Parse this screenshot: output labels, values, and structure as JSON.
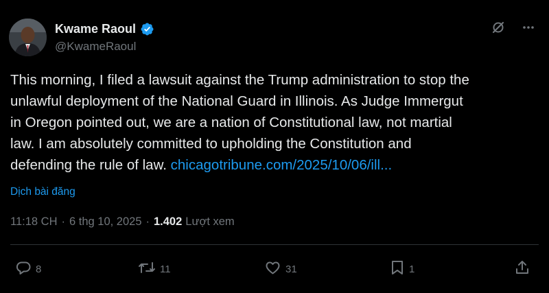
{
  "author": {
    "display_name": "Kwame Raoul",
    "handle": "@KwameRaoul",
    "verified": true
  },
  "tweet": {
    "lines": [
      "This morning, I filed a lawsuit against the Trump administration to stop the",
      "unlawful deployment of the National Guard in Illinois. As Judge Immergut",
      "in Oregon pointed out, we are a nation of Constitutional law, not martial",
      "law. I am absolutely committed to upholding the Constitution and",
      "defending the rule of law."
    ],
    "link_text": "chicagotribune.com/2025/10/06/ill...",
    "translate_label": "Dịch bài đăng"
  },
  "meta": {
    "time": "11:18 CH",
    "date": "6 thg 10, 2025",
    "separator": "·",
    "views_count": "1.402",
    "views_label": "Lượt xem"
  },
  "actions": {
    "replies": "8",
    "reposts": "11",
    "likes": "31",
    "bookmarks": "1"
  },
  "icons": {
    "verified": "verified-badge-icon",
    "grok": "grok-icon",
    "more": "more-icon",
    "reply": "reply-icon",
    "repost": "repost-icon",
    "like": "like-icon",
    "bookmark": "bookmark-icon",
    "share": "share-icon"
  },
  "colors": {
    "background": "#000000",
    "text": "#e7e9ea",
    "secondary": "#71767b",
    "accent": "#1d9bf0"
  }
}
